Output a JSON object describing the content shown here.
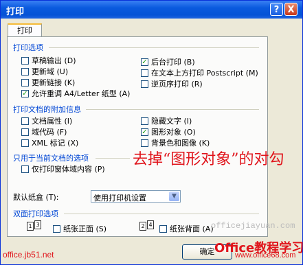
{
  "window": {
    "title": "打印",
    "help_label": "?",
    "close_label": "X",
    "tab_label": "打印"
  },
  "print_options": {
    "section_title": "打印选项",
    "left": [
      {
        "label": "草稿输出 (D)",
        "checked": false
      },
      {
        "label": "更新域 (U)",
        "checked": false
      },
      {
        "label": "更新链接 (K)",
        "checked": false
      },
      {
        "label": "允许重调 A4/Letter 纸型 (A)",
        "checked": true
      }
    ],
    "right": [
      {
        "label": "后台打印 (B)",
        "checked": true
      },
      {
        "label": "在文本上方打印 Postscript (M)",
        "checked": false
      },
      {
        "label": "逆页序打印 (R)",
        "checked": false
      }
    ]
  },
  "document_info": {
    "section_title": "打印文档的附加信息",
    "left": [
      {
        "label": "文档属性 (I)",
        "checked": false
      },
      {
        "label": "域代码 (F)",
        "checked": false
      },
      {
        "label": "XML 标记 (X)",
        "checked": false
      }
    ],
    "right": [
      {
        "label": "隐藏文字 (I)",
        "checked": false
      },
      {
        "label": "图形对象 (O)",
        "checked": true
      },
      {
        "label": "背景色和图像 (K)",
        "checked": false
      }
    ]
  },
  "current_doc": {
    "section_title": "只用于当前文档的选项",
    "items": [
      {
        "label": "仅打印窗体域内容 (P)",
        "checked": false
      }
    ]
  },
  "tray": {
    "label": "默认纸盒 (T):",
    "value": "使用打印机设置",
    "arrow": "▼"
  },
  "duplex": {
    "section_title": "双面打印选项",
    "front": {
      "label": "纸张正面 (S)",
      "checked": false,
      "pages": [
        "1",
        "3"
      ]
    },
    "back": {
      "label": "纸张背面 (A)",
      "checked": false,
      "pages": [
        "2",
        "4"
      ]
    }
  },
  "annotation": "去掉“图形对象”的对勾",
  "ok_button": "确定",
  "watermarks": {
    "left": "office.jb51.net",
    "right": "officejiayuan.com",
    "brand": "Office教程学习网",
    "brand_url": "www.office68.com"
  }
}
